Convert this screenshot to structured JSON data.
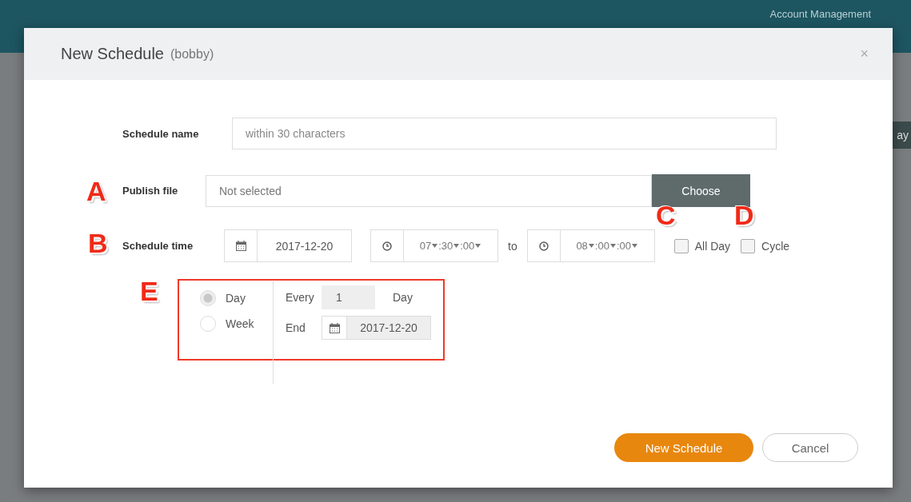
{
  "backdrop": {
    "header_link": "Account Management",
    "button_fragment": "ay"
  },
  "dialog": {
    "title": "New Schedule",
    "subtitle": "(bobby)",
    "close": "×"
  },
  "form": {
    "schedule_name": {
      "label": "Schedule name",
      "placeholder": "within 30 characters"
    },
    "publish_file": {
      "label": "Publish file",
      "value": "Not selected",
      "button": "Choose"
    },
    "schedule_time": {
      "label": "Schedule time",
      "date": "2017-12-20",
      "start": [
        "07",
        ":30",
        ":00"
      ],
      "separator": "to",
      "end": [
        "08",
        ":00",
        ":00"
      ],
      "options": [
        {
          "label": "All Day",
          "checked": false
        },
        {
          "label": "Cycle",
          "checked": false
        }
      ]
    },
    "cycle": {
      "modes": [
        {
          "label": "Day",
          "selected": true,
          "disabled": true
        },
        {
          "label": "Week",
          "selected": false,
          "disabled": false
        }
      ],
      "every_label": "Every",
      "every_value": "1",
      "every_unit": "Day",
      "end_label": "End",
      "end_date": "2017-12-20"
    }
  },
  "annotations": [
    {
      "letter": "A"
    },
    {
      "letter": "B"
    },
    {
      "letter": "C"
    },
    {
      "letter": "D"
    },
    {
      "letter": "E"
    }
  ],
  "buttons": [
    {
      "label": "New Schedule",
      "kind": "primary"
    },
    {
      "label": "Cancel",
      "kind": "secondary"
    }
  ]
}
